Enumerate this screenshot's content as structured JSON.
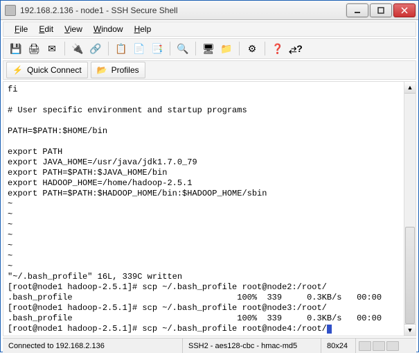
{
  "titlebar": {
    "text": "192.168.2.136 - node1 - SSH Secure Shell"
  },
  "menu": {
    "file": "File",
    "edit": "Edit",
    "view": "View",
    "window": "Window",
    "help": "Help"
  },
  "secondary": {
    "quick_connect": "Quick Connect",
    "profiles": "Profiles"
  },
  "terminal": {
    "lines": [
      "fi",
      "",
      "# User specific environment and startup programs",
      "",
      "PATH=$PATH:$HOME/bin",
      "",
      "export PATH",
      "export JAVA_HOME=/usr/java/jdk1.7.0_79",
      "export PATH=$PATH:$JAVA_HOME/bin",
      "export HADOOP_HOME=/home/hadoop-2.5.1",
      "export PATH=$PATH:$HADOOP_HOME/bin:$HADOOP_HOME/sbin",
      "~",
      "~",
      "~",
      "~",
      "~",
      "~",
      "~",
      "\"~/.bash_profile\" 16L, 339C written",
      "[root@node1 hadoop-2.5.1]# scp ~/.bash_profile root@node2:/root/",
      ".bash_profile                                 100%  339     0.3KB/s   00:00",
      "[root@node1 hadoop-2.5.1]# scp ~/.bash_profile root@node3:/root/",
      ".bash_profile                                 100%  339     0.3KB/s   00:00",
      "[root@node1 hadoop-2.5.1]# scp ~/.bash_profile root@node4:/root/"
    ]
  },
  "status": {
    "connected": "Connected to 192.168.2.136",
    "cipher": "SSH2 - aes128-cbc - hmac-md5",
    "size": "80x24"
  }
}
